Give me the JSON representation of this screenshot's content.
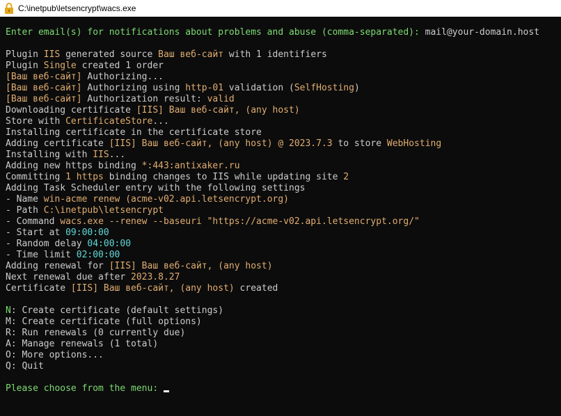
{
  "window": {
    "title": "C:\\inetpub\\letsencrypt\\wacs.exe",
    "icon": "lock-icon",
    "colors": {
      "icon": "#e5a619"
    }
  },
  "console": {
    "colors": {
      "background": "#0c0c0c",
      "text": "#cccccc",
      "highlight": "#e0ad71",
      "prompt": "#7ddb73",
      "value": "#61d6d6"
    },
    "lines": [
      [
        [
          "green",
          "Enter email(s) for notifications about problems and abuse (comma-separated): "
        ],
        [
          "white",
          "mail@your-domain.host"
        ]
      ],
      [],
      [
        [
          "white",
          "Plugin "
        ],
        [
          "yellow",
          "IIS"
        ],
        [
          "white",
          " generated source "
        ],
        [
          "yellow",
          "Ваш веб-сайт"
        ],
        [
          "white",
          " with 1 identifiers"
        ]
      ],
      [
        [
          "white",
          "Plugin "
        ],
        [
          "yellow",
          "Single"
        ],
        [
          "white",
          " created 1 order"
        ]
      ],
      [
        [
          "yellow",
          "[Ваш веб-сайт]"
        ],
        [
          "white",
          " Authorizing..."
        ]
      ],
      [
        [
          "yellow",
          "[Ваш веб-сайт]"
        ],
        [
          "white",
          " Authorizing using "
        ],
        [
          "yellow",
          "http-01"
        ],
        [
          "white",
          " validation ("
        ],
        [
          "yellow",
          "SelfHosting"
        ],
        [
          "white",
          ")"
        ]
      ],
      [
        [
          "yellow",
          "[Ваш веб-сайт]"
        ],
        [
          "white",
          " Authorization result: "
        ],
        [
          "yellow",
          "valid"
        ]
      ],
      [
        [
          "white",
          "Downloading certificate "
        ],
        [
          "yellow",
          "[IIS] Ваш веб-сайт, (any host)"
        ]
      ],
      [
        [
          "white",
          "Store with "
        ],
        [
          "yellow",
          "CertificateStore"
        ],
        [
          "white",
          "..."
        ]
      ],
      [
        [
          "white",
          "Installing certificate in the certificate store"
        ]
      ],
      [
        [
          "white",
          "Adding certificate "
        ],
        [
          "yellow",
          "[IIS] Ваш веб-сайт, (any host) @ 2023.7.3"
        ],
        [
          "white",
          " to store "
        ],
        [
          "yellow",
          "WebHosting"
        ]
      ],
      [
        [
          "white",
          "Installing with "
        ],
        [
          "yellow",
          "IIS"
        ],
        [
          "white",
          "..."
        ]
      ],
      [
        [
          "white",
          "Adding new https binding "
        ],
        [
          "yellow",
          "*:443:antixaker.ru"
        ]
      ],
      [
        [
          "white",
          "Committing "
        ],
        [
          "yellow",
          "1"
        ],
        [
          "white",
          " "
        ],
        [
          "yellow",
          "https"
        ],
        [
          "white",
          " binding changes to IIS while updating site "
        ],
        [
          "yellow",
          "2"
        ]
      ],
      [
        [
          "white",
          "Adding Task Scheduler entry with the following settings"
        ]
      ],
      [
        [
          "white",
          "- Name "
        ],
        [
          "yellow",
          "win-acme renew (acme-v02.api.letsencrypt.org)"
        ]
      ],
      [
        [
          "white",
          "- Path "
        ],
        [
          "yellow",
          "C:\\inetpub\\letsencrypt"
        ]
      ],
      [
        [
          "white",
          "- Command "
        ],
        [
          "yellow",
          "wacs.exe --renew --baseuri \"https://acme-v02.api.letsencrypt.org/\""
        ]
      ],
      [
        [
          "white",
          "- Start at "
        ],
        [
          "cyan",
          "09:00:00"
        ]
      ],
      [
        [
          "white",
          "- Random delay "
        ],
        [
          "cyan",
          "04:00:00"
        ]
      ],
      [
        [
          "white",
          "- Time limit "
        ],
        [
          "cyan",
          "02:00:00"
        ]
      ],
      [
        [
          "white",
          "Adding renewal for "
        ],
        [
          "yellow",
          "[IIS] Ваш веб-сайт, (any host)"
        ]
      ],
      [
        [
          "white",
          "Next renewal due after "
        ],
        [
          "yellow",
          "2023.8.27"
        ]
      ],
      [
        [
          "white",
          "Certificate "
        ],
        [
          "yellow",
          "[IIS] Ваш веб-сайт, (any host)"
        ],
        [
          "white",
          " created"
        ]
      ],
      [],
      [
        [
          "green",
          "N"
        ],
        [
          "white",
          ": Create certificate (default settings)"
        ]
      ],
      [
        [
          "white",
          "M: Create certificate (full options)"
        ]
      ],
      [
        [
          "white",
          "R: Run renewals (0 currently due)"
        ]
      ],
      [
        [
          "white",
          "A: Manage renewals (1 total)"
        ]
      ],
      [
        [
          "white",
          "O: More options..."
        ]
      ],
      [
        [
          "white",
          "Q: Quit"
        ]
      ],
      [],
      [
        [
          "green",
          "Please choose from the menu: "
        ]
      ]
    ]
  }
}
